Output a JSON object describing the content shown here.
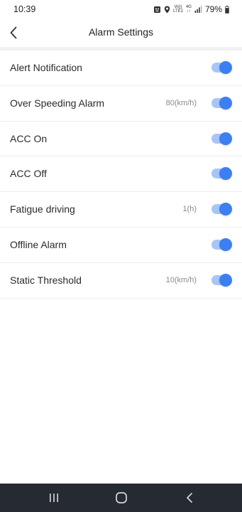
{
  "status_bar": {
    "time": "10:39",
    "volte_top": "Vo))",
    "volte_bottom": "LTE1",
    "network_top": "4G",
    "network_bottom": "↓↑",
    "battery": "79%",
    "icons": [
      "app-notification-icon",
      "location-icon",
      "volte-icon",
      "network-4g-icon",
      "signal-icon",
      "battery-icon"
    ]
  },
  "header": {
    "title": "Alarm Settings",
    "back_icon": "chevron-left-icon"
  },
  "settings": [
    {
      "label": "Alert Notification",
      "value": "",
      "enabled": true
    },
    {
      "label": "Over Speeding Alarm",
      "value": "80(km/h)",
      "enabled": true
    },
    {
      "label": "ACC On",
      "value": "",
      "enabled": true
    },
    {
      "label": "ACC Off",
      "value": "",
      "enabled": true
    },
    {
      "label": "Fatigue driving",
      "value": "1(h)",
      "enabled": true
    },
    {
      "label": "Offline Alarm",
      "value": "",
      "enabled": true
    },
    {
      "label": "Static Threshold",
      "value": "10(km/h)",
      "enabled": true
    }
  ],
  "nav_bar": {
    "buttons": [
      "recent-apps-icon",
      "home-icon",
      "back-icon"
    ]
  },
  "colors": {
    "toggle_knob": "#3c7ff2",
    "toggle_track": "#a7c6f8",
    "nav_bar_bg": "#262a33"
  }
}
